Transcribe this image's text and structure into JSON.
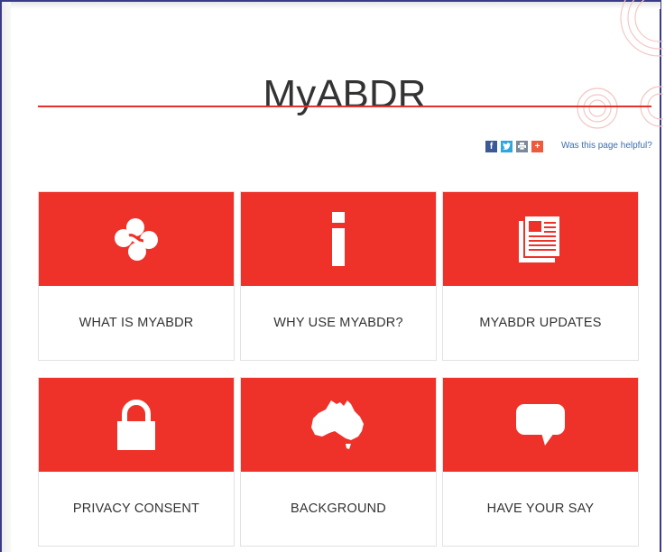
{
  "page": {
    "title": "MyABDR",
    "helpful_link": "Was this page helpful?"
  },
  "share": [
    {
      "icon": "facebook-icon",
      "glyph": "f"
    },
    {
      "icon": "twitter-icon",
      "glyph": "t"
    },
    {
      "icon": "print-icon",
      "glyph": "p"
    },
    {
      "icon": "plus-share-icon",
      "glyph": "+"
    }
  ],
  "tiles": [
    {
      "label": "WHAT IS MYABDR",
      "icon": "myabdr-logo-icon"
    },
    {
      "label": "WHY USE MYABDR?",
      "icon": "info-icon"
    },
    {
      "label": "MYABDR UPDATES",
      "icon": "newspaper-icon"
    },
    {
      "label": "PRIVACY CONSENT",
      "icon": "padlock-icon"
    },
    {
      "label": "BACKGROUND",
      "icon": "australia-map-icon"
    },
    {
      "label": "HAVE YOUR SAY",
      "icon": "speech-bubble-icon"
    }
  ],
  "colors": {
    "accent": "#ee3129",
    "title_text": "#333333",
    "link": "#3a6fb0"
  }
}
